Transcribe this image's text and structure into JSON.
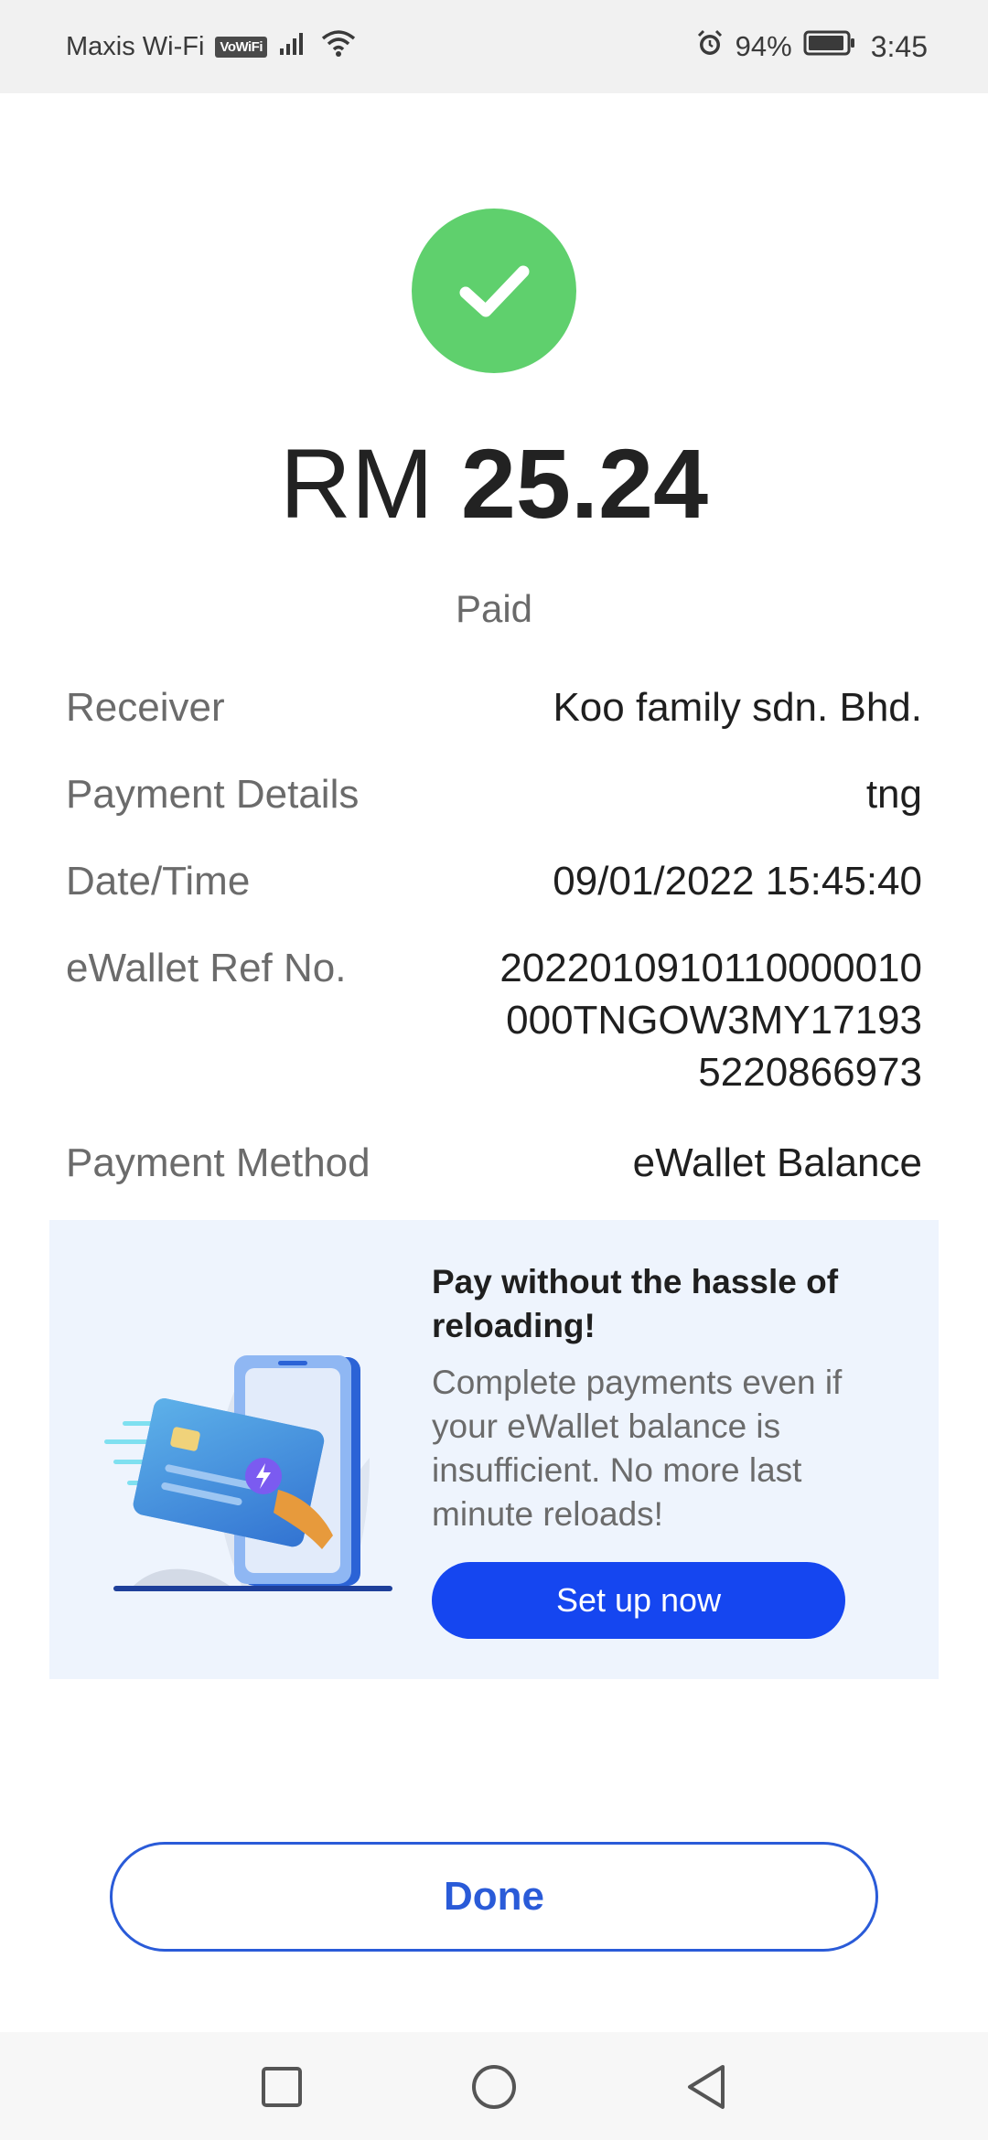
{
  "status_bar": {
    "carrier": "Maxis Wi-Fi",
    "vowifi": "VoWiFi",
    "battery_percent": "94%",
    "time": "3:45",
    "icons": [
      "signal-icon",
      "wifi-icon",
      "alarm-icon",
      "battery-icon"
    ]
  },
  "payment": {
    "currency": "RM",
    "amount": "25.24",
    "status": "Paid",
    "status_icon": "check-circle-icon",
    "status_color": "#5fd06d"
  },
  "details": {
    "receiver_label": "Receiver",
    "receiver_value": "Koo family sdn. Bhd.",
    "payment_details_label": "Payment Details",
    "payment_details_value": "tng",
    "datetime_label": "Date/Time",
    "datetime_value": "09/01/2022 15:45:40",
    "ref_label": "eWallet Ref No.",
    "ref_value": "2022010910110000010000TNGOW3MY171935220866973",
    "method_label": "Payment Method",
    "method_value": "eWallet Balance"
  },
  "promo": {
    "title": "Pay without the hassle of reloading!",
    "description": "Complete payments even if your eWallet balance is insufficient. No more last minute reloads!",
    "button_label": "Set up now",
    "button_color": "#1546f0",
    "background": "#eef4fd"
  },
  "actions": {
    "done_label": "Done",
    "accent": "#2a5bd8"
  },
  "nav": {
    "icons": [
      "recent-apps-icon",
      "home-icon",
      "back-icon"
    ]
  }
}
